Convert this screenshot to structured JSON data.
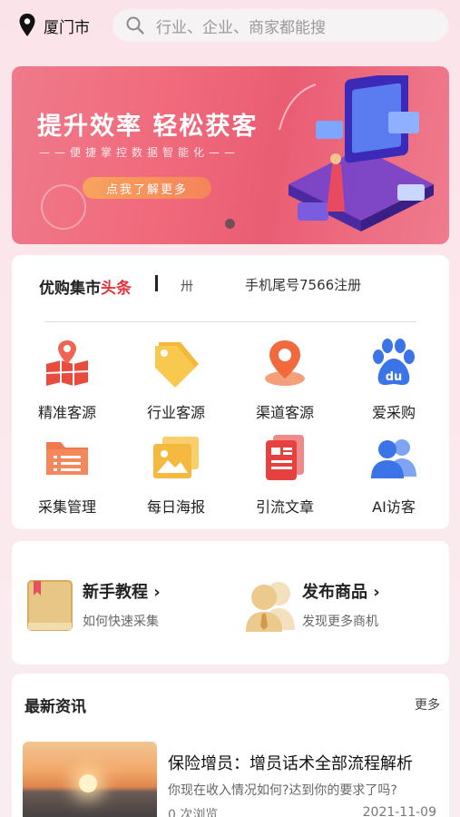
{
  "location": {
    "city": "厦门市"
  },
  "search": {
    "placeholder": "行业、企业、商家都能搜"
  },
  "banner": {
    "title": "提升效率 轻松获客",
    "subtitle": "——便捷掌控数据智能化——",
    "cta": "点我了解更多"
  },
  "headline": {
    "brand": "优购集市",
    "tag": "头条",
    "icon_glyph": "卅",
    "ticker": "手机尾号7566注册"
  },
  "grid": [
    {
      "label": "精准客源",
      "icon": "map-icon"
    },
    {
      "label": "行业客源",
      "icon": "tag-icon"
    },
    {
      "label": "渠道客源",
      "icon": "location-pin-icon"
    },
    {
      "label": "爱采购",
      "icon": "baidu-paw-icon"
    },
    {
      "label": "采集管理",
      "icon": "folder-icon"
    },
    {
      "label": "每日海报",
      "icon": "image-icon"
    },
    {
      "label": "引流文章",
      "icon": "document-icon"
    },
    {
      "label": "AI访客",
      "icon": "users-icon"
    }
  ],
  "tutorial": {
    "title": "新手教程",
    "subtitle": "如何快速采集"
  },
  "publish": {
    "title": "发布商品",
    "subtitle": "发现更多商机"
  },
  "news": {
    "section_title": "最新资讯",
    "more": "更多",
    "item": {
      "title": "保险增员：增员话术全部流程解析",
      "desc": "你现在收入情况如何?达到你的要求了吗?",
      "views": "0 次浏览",
      "date": "2021-11-09"
    }
  },
  "colors": {
    "accent": "#e3323b",
    "banner": "#f06a7c",
    "cta": "#f5835a"
  }
}
